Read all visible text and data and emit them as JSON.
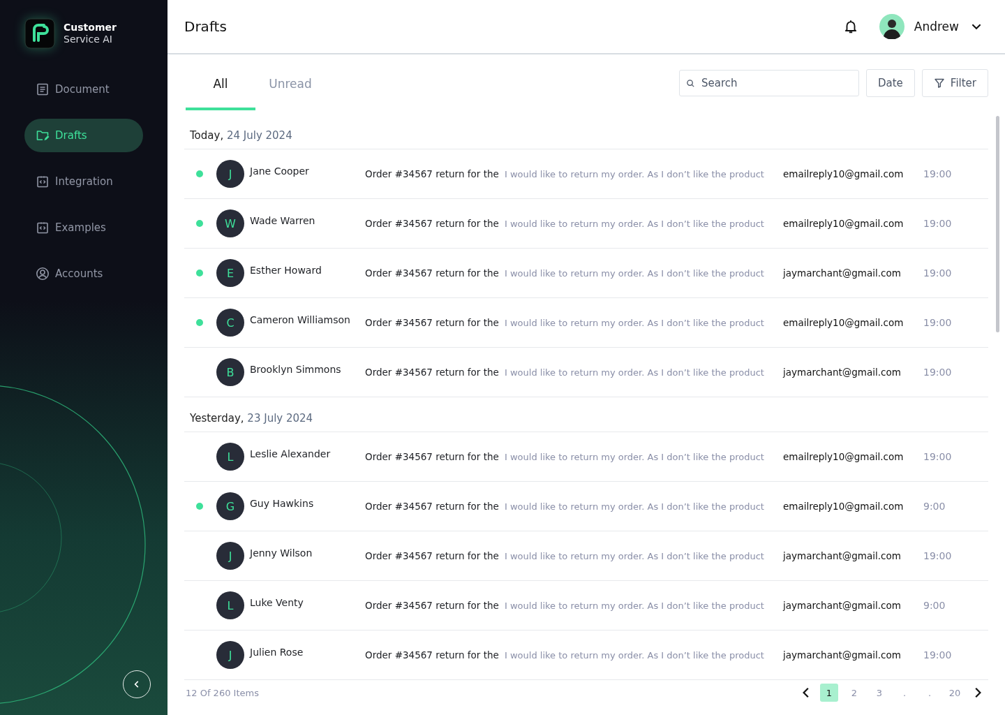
{
  "brand": {
    "line_1": "Customer",
    "line_2": "Service AI"
  },
  "sidebar": {
    "items": [
      {
        "label": "Document",
        "kind": "document",
        "selected": false
      },
      {
        "label": "Drafts",
        "kind": "drafts",
        "selected": true
      },
      {
        "label": "Integration",
        "kind": "code",
        "selected": false
      },
      {
        "label": "Examples",
        "kind": "code",
        "selected": false
      },
      {
        "label": "Accounts",
        "kind": "account",
        "selected": false
      }
    ]
  },
  "header": {
    "title": "Drafts",
    "user": "Andrew"
  },
  "tabs": [
    {
      "label": "All",
      "selected": true
    },
    {
      "label": "Unread",
      "selected": false
    }
  ],
  "search": {
    "placeholder": "Search"
  },
  "buttons": [
    {
      "label": "Date",
      "kind": "plain"
    },
    {
      "label": "Filter",
      "kind": "filter"
    }
  ],
  "groups": [
    {
      "day": "Today,",
      "date": "24 July 2024",
      "rows": [
        {
          "unread": true,
          "initial": "J",
          "name": "Jane Cooper",
          "subject": "Order #34567 return for the",
          "preview": "I would like to return my order. As I don’t like the product",
          "email": "emailreply10@gmail.com",
          "time": "19:00"
        },
        {
          "unread": true,
          "initial": "W",
          "name": "Wade Warren",
          "subject": "Order #34567 return for the",
          "preview": "I would like to return my order. As I don’t like the product",
          "email": "emailreply10@gmail.com",
          "time": "19:00"
        },
        {
          "unread": true,
          "initial": "E",
          "name": "Esther Howard",
          "subject": "Order #34567 return for the",
          "preview": "I would like to return my order. As I don’t like the product",
          "email": "jaymarchant@gmail.com",
          "time": "19:00"
        },
        {
          "unread": true,
          "initial": "C",
          "name": "Cameron Williamson",
          "subject": "Order #34567 return for the",
          "preview": "I would like to return my order. As I don’t like the product",
          "email": "emailreply10@gmail.com",
          "time": "19:00"
        },
        {
          "unread": false,
          "initial": "B",
          "name": "Brooklyn Simmons",
          "subject": "Order #34567 return for the",
          "preview": "I would like to return my order. As I don’t like the product",
          "email": "jaymarchant@gmail.com",
          "time": "19:00"
        }
      ]
    },
    {
      "day": "Yesterday,",
      "date": "23 July 2024",
      "rows": [
        {
          "unread": false,
          "initial": "L",
          "name": "Leslie Alexander",
          "subject": "Order #34567 return for the",
          "preview": "I would like to return my order. As I don’t like the product",
          "email": "emailreply10@gmail.com",
          "time": "19:00"
        },
        {
          "unread": true,
          "initial": "G",
          "name": "Guy Hawkins",
          "subject": "Order #34567 return for the",
          "preview": "I would like to return my order. As I don’t like the product",
          "email": "emailreply10@gmail.com",
          "time": "9:00"
        },
        {
          "unread": false,
          "initial": "J",
          "name": "Jenny Wilson",
          "subject": "Order #34567 return for the",
          "preview": "I would like to return my order. As I don’t like the product",
          "email": "jaymarchant@gmail.com",
          "time": "19:00"
        },
        {
          "unread": false,
          "initial": "L",
          "name": "Luke Venty",
          "subject": "Order #34567 return for the",
          "preview": "I would like to return my order. As I don’t like the product",
          "email": "jaymarchant@gmail.com",
          "time": "9:00"
        },
        {
          "unread": false,
          "initial": "J",
          "name": "Julien Rose",
          "subject": "Order #34567 return for the",
          "preview": "I would like to return my order. As I don’t like the product",
          "email": "jaymarchant@gmail.com",
          "time": "19:00"
        }
      ]
    }
  ],
  "footer": {
    "count": "12 Of 260 Items"
  },
  "pages": [
    {
      "label": "1",
      "selected": true
    },
    {
      "label": "2",
      "selected": false
    },
    {
      "label": "3",
      "selected": false
    },
    {
      "label": ".",
      "selected": false
    },
    {
      "label": ".",
      "selected": false
    },
    {
      "label": "20",
      "selected": false
    }
  ]
}
